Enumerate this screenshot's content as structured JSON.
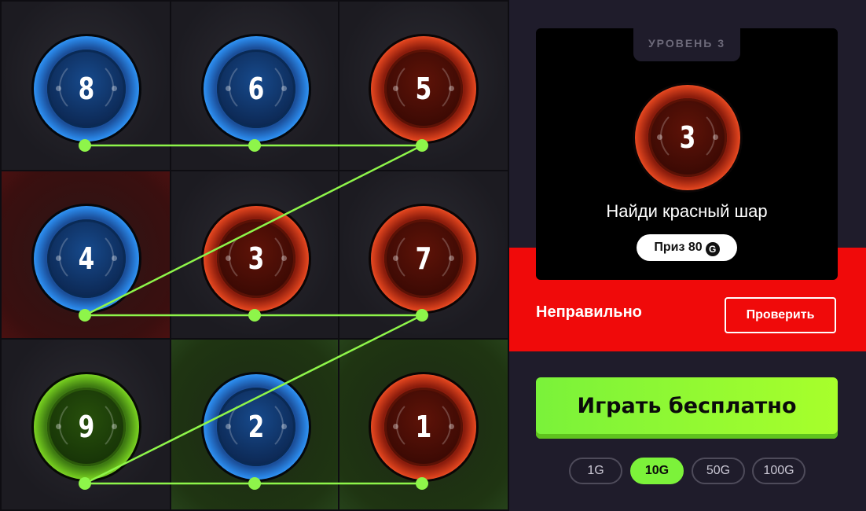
{
  "board": {
    "balls": [
      {
        "number": "8",
        "color": "blue"
      },
      {
        "number": "6",
        "color": "blue"
      },
      {
        "number": "5",
        "color": "red"
      },
      {
        "number": "4",
        "color": "blue"
      },
      {
        "number": "3",
        "color": "red"
      },
      {
        "number": "7",
        "color": "red"
      },
      {
        "number": "9",
        "color": "green"
      },
      {
        "number": "2",
        "color": "blue"
      },
      {
        "number": "1",
        "color": "red"
      }
    ],
    "highlighted_cells": {
      "4": "red",
      "2": "green",
      "1": "green"
    },
    "path_color": "#8ef54a"
  },
  "panel": {
    "level_label": "УРОВЕНЬ 3",
    "target_number": "3",
    "target_color": "red",
    "task_text": "Найди красный шар",
    "prize_label": "Приз 80",
    "currency_icon": "G",
    "result_text": "Неправильно",
    "check_button": "Проверить",
    "play_button": "Играть бесплатно",
    "bets": [
      {
        "label": "1G",
        "active": false
      },
      {
        "label": "10G",
        "active": true
      },
      {
        "label": "50G",
        "active": false
      },
      {
        "label": "100G",
        "active": false
      }
    ],
    "accent_red": "#f00a0a",
    "accent_green": "#8ef54a"
  }
}
